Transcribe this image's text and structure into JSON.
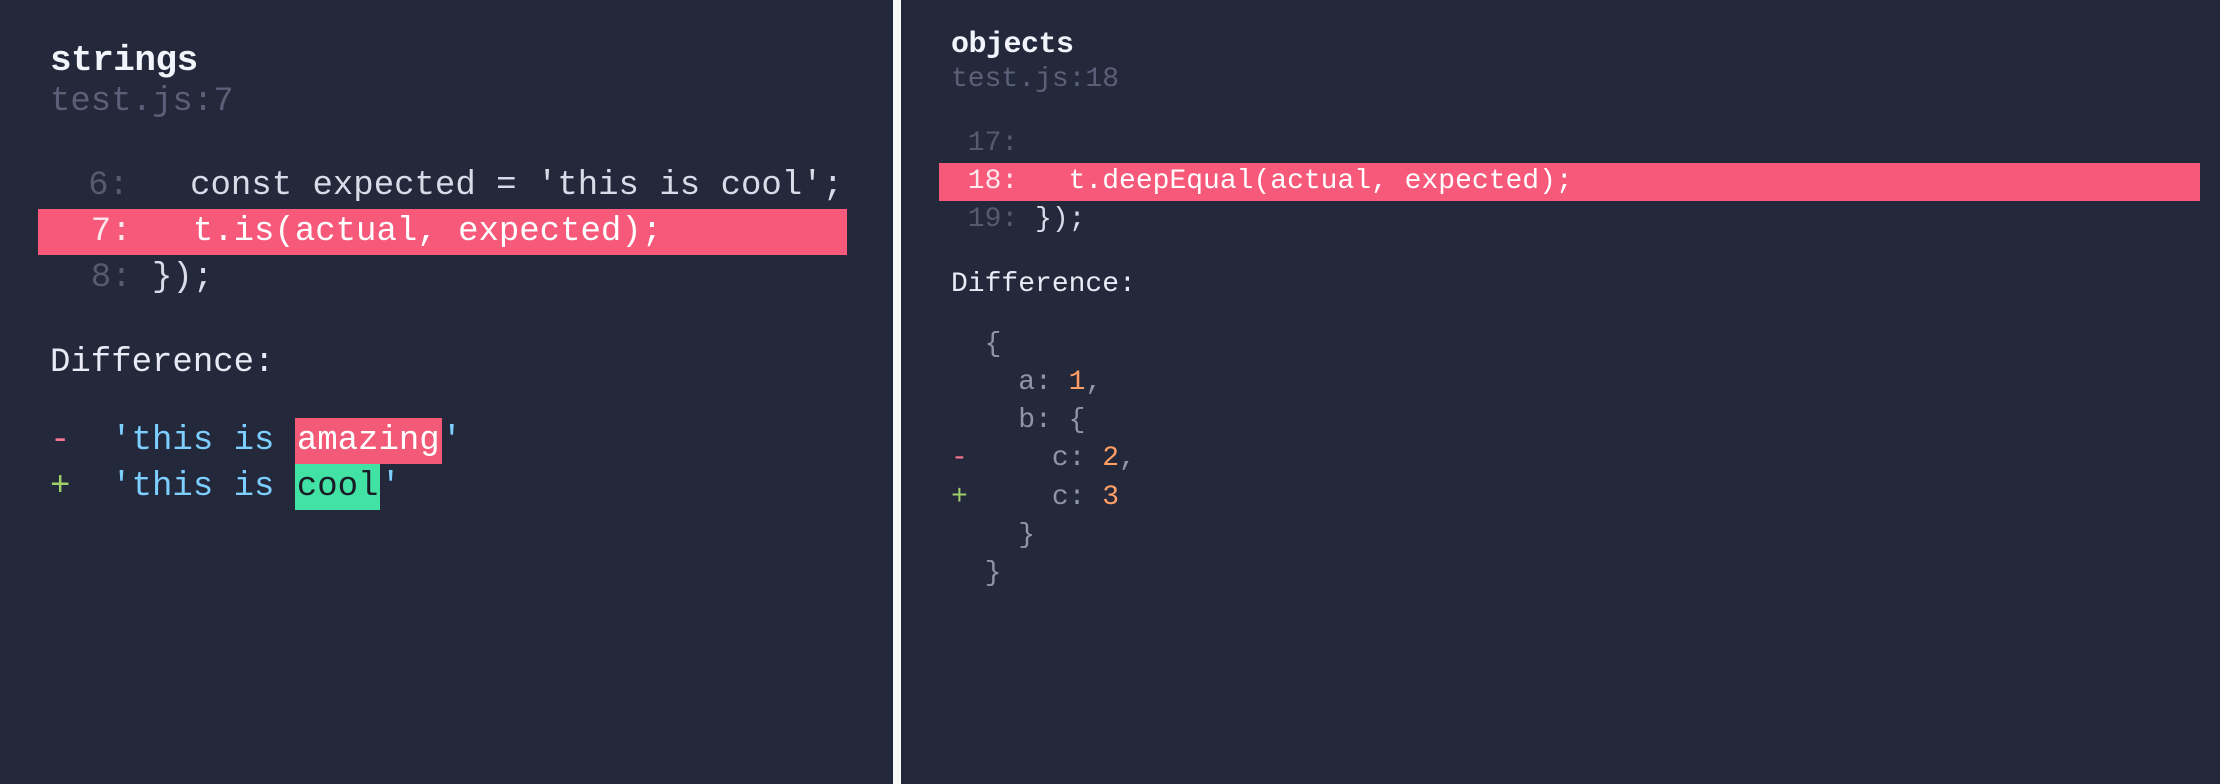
{
  "left": {
    "title": "strings",
    "location": "test.js:7",
    "code": {
      "lines": [
        {
          "num": "6",
          "text": "   const expected = 'this is cool';",
          "hl": false
        },
        {
          "num": "7",
          "text": "   t.is(actual, expected);",
          "hl": true
        },
        {
          "num": "8",
          "text": " });",
          "hl": false
        }
      ]
    },
    "diff_label": "Difference:",
    "string_diff": {
      "minus": {
        "prefix": "'this is ",
        "highlight": "amazing",
        "suffix": "'"
      },
      "plus": {
        "prefix": "'this is ",
        "highlight": "cool",
        "suffix": "'"
      }
    }
  },
  "right": {
    "title": "objects",
    "location": "test.js:18",
    "code": {
      "lines": [
        {
          "num": "17",
          "text": "",
          "hl": false
        },
        {
          "num": "18",
          "text": "   t.deepEqual(actual, expected);",
          "hl": true
        },
        {
          "num": "19",
          "text": " });",
          "hl": false
        }
      ]
    },
    "diff_label": "Difference:",
    "obj_diff": {
      "open": "{",
      "a_key": "a:",
      "a_val": "1",
      "a_comma": ",",
      "b_key": "b:",
      "b_open": "{",
      "c_key_minus": "c:",
      "c_val_minus": "2",
      "c_comma_minus": ",",
      "c_key_plus": "c:",
      "c_val_plus": "3",
      "b_close": "}",
      "close": "}"
    }
  }
}
